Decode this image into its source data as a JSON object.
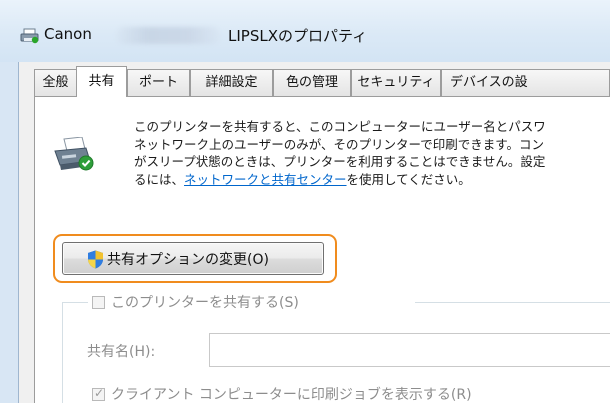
{
  "window": {
    "title_brand": "Canon",
    "title_name": "LIPSLXのプロパティ"
  },
  "tabs": [
    {
      "label": "全般",
      "active": false
    },
    {
      "label": "共有",
      "active": true
    },
    {
      "label": "ポート",
      "active": false
    },
    {
      "label": "詳細設定",
      "active": false
    },
    {
      "label": "色の管理",
      "active": false
    },
    {
      "label": "セキュリティ",
      "active": false
    },
    {
      "label": "デバイスの設",
      "active": false
    }
  ],
  "description": {
    "line1": "このプリンターを共有すると、このコンピューターにユーザー名とパスワ",
    "line2": "ネットワーク上のユーザーのみが、そのプリンターで印刷できます。コン",
    "line3": "がスリープ状態のときは、プリンターを利用することはできません。設定",
    "line4_link": "ネットワークと共有センター",
    "line4_prefix": "るには、",
    "line4_suffix": "を使用してください。"
  },
  "change_sharing_button": {
    "label": "共有オプションの変更(O)"
  },
  "share_checkbox": {
    "label": "このプリンターを共有する(S)",
    "checked": false
  },
  "share_name": {
    "label": "共有名(H):",
    "value": ""
  },
  "render_jobs_checkbox": {
    "label": "クライアント コンピューターに印刷ジョブを表示する(R)",
    "checked": true
  },
  "colors": {
    "highlight": "#f08c1e",
    "link": "#0066cc",
    "disabled_text": "#8d8d8d"
  }
}
